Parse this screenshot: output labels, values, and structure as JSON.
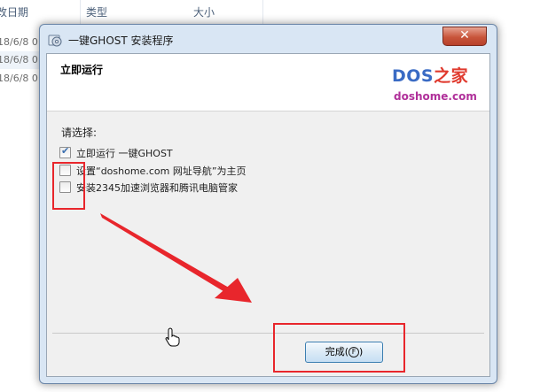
{
  "explorer": {
    "columns": [
      "改日期",
      "类型",
      "大小"
    ],
    "rows": [
      "18/6/8 0",
      "18/6/8 0",
      "18/6/8 0"
    ]
  },
  "dialog": {
    "title": "一键GHOST 安装程序",
    "close_symbol": "✕",
    "banner": {
      "title": "立即运行",
      "logo_prefix": "DOS",
      "logo_suffix": "之家",
      "logo_domain": "doshome.com"
    },
    "prompt": "请选择:",
    "options": [
      {
        "label": "立即运行 一键GHOST",
        "checked": true
      },
      {
        "label": "设置“doshome.com 网址导航”为主页",
        "checked": false
      },
      {
        "label": "安装2345加速浏览器和腾讯电脑管家",
        "checked": false
      }
    ],
    "finish_button": {
      "label": "完成",
      "accel": "F"
    }
  },
  "colors": {
    "annotation": "#e8262c",
    "logo_blue": "#3a6bc4",
    "logo_magenta": "#b0309a"
  },
  "icons": {
    "app": "installer-disc-icon",
    "check": "checkmark-icon",
    "cursor": "hand-pointer-icon"
  }
}
